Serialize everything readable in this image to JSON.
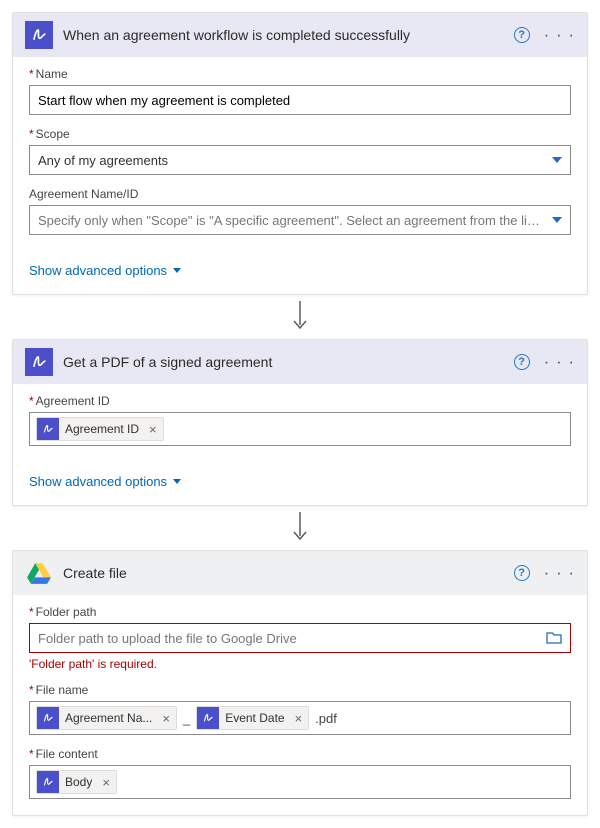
{
  "cards": [
    {
      "title": "When an agreement workflow is completed successfully",
      "fields": {
        "name": {
          "label": "Name",
          "value": "Start flow when my agreement is completed"
        },
        "scope": {
          "label": "Scope",
          "value": "Any of my agreements"
        },
        "agreement_name_id": {
          "label": "Agreement Name/ID",
          "placeholder": "Specify only when \"Scope\" is \"A specific agreement\". Select an agreement from the list or enter th"
        }
      },
      "advanced": "Show advanced options"
    },
    {
      "title": "Get a PDF of a signed agreement",
      "fields": {
        "agreement_id": {
          "label": "Agreement ID",
          "tokens": [
            {
              "name": "Agreement ID"
            }
          ]
        }
      },
      "advanced": "Show advanced options"
    },
    {
      "title": "Create file",
      "fields": {
        "folder_path": {
          "label": "Folder path",
          "placeholder": "Folder path to upload the file to Google Drive",
          "error": "'Folder path' is required."
        },
        "file_name": {
          "label": "File name",
          "tokens": [
            {
              "name": "Agreement Na..."
            }
          ],
          "sep1": "_",
          "tokens2": [
            {
              "name": "Event Date"
            }
          ],
          "suffix": ".pdf"
        },
        "file_content": {
          "label": "File content",
          "tokens": [
            {
              "name": "Body"
            }
          ]
        }
      }
    }
  ]
}
